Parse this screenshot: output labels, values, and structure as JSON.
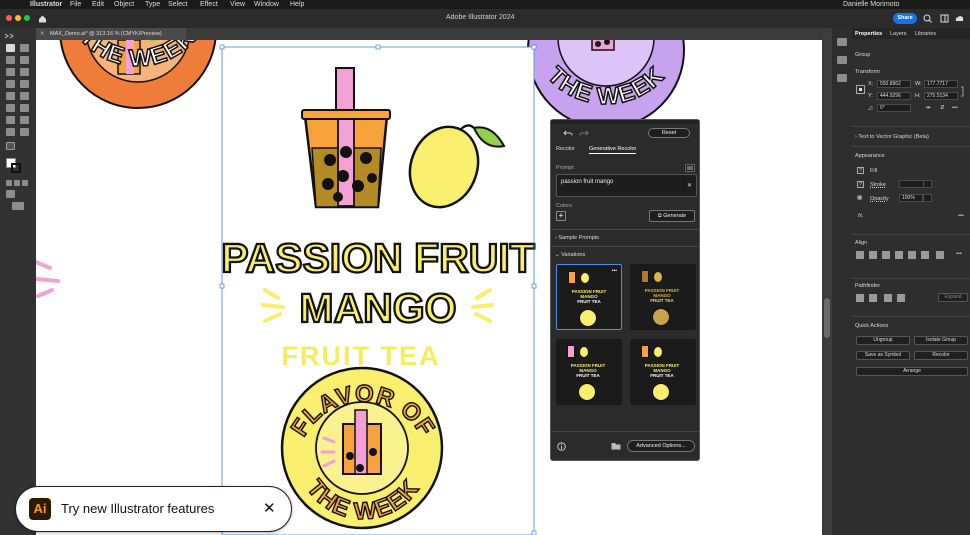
{
  "menubar": {
    "apple": "",
    "app_name": "Illustrator",
    "items": [
      "File",
      "Edit",
      "Object",
      "Type",
      "Select",
      "Effect",
      "View",
      "Window",
      "Help"
    ],
    "user": "Danielle Morimoto"
  },
  "titlebar": {
    "title": "Adobe Illustrator 2024",
    "share": "Share"
  },
  "doc_tab": {
    "label": "MAX_Demo.ai* @ 313.16 % (CMYK/Preview)"
  },
  "artwork": {
    "headline_1": "PASSION FRUIT",
    "headline_2": "MANGO",
    "subtitle": "FRUIT TEA",
    "badge_top": "FLAVOR OF",
    "badge_bottom": "THE WEEK",
    "partial_left": "THE WEEK",
    "partial_right": "THE WEEK"
  },
  "properties": {
    "tabs": [
      "Properties",
      "Layers",
      "Libraries"
    ],
    "group": "Group",
    "transform": "Transform",
    "x": "550.8962",
    "y": "444.9296",
    "w": "177.7717",
    "h": "275.5134",
    "angle": "0°",
    "text_to_vector": "Text to Vector Graphic (Beta)",
    "appearance": "Appearance",
    "fill": "Fill",
    "stroke": "Stroke",
    "opacity": "Opacity",
    "opacity_value": "100%",
    "fx": "fx.",
    "align": "Align",
    "pathfinder": "Pathfinder",
    "expand": "Expand",
    "quick_actions": "Quick Actions",
    "ungroup": "Ungroup",
    "isolate_group": "Isolate Group",
    "save_as_symbol": "Save as Symbol",
    "recolor": "Recolor",
    "arrange": "Arrange"
  },
  "recolor": {
    "reset": "Reset",
    "tab_recolor": "Recolor",
    "tab_generative": "Generative Recolor",
    "prompt_label": "Prompt",
    "prompt_value": "passion fruit mango",
    "colors_label": "Colors",
    "generate": "Generate",
    "sample_prompts": "Sample Prompts",
    "variations": "Variations",
    "thumb_line1": "PASSION FRUIT",
    "thumb_line2": "MANGO",
    "thumb_line3": "FRUIT TEA",
    "thumb_more": "•••",
    "advanced": "Advanced Options..."
  },
  "notification": {
    "logo": "Ai",
    "text": "Try new Illustrator features",
    "close": "✕"
  },
  "colors": {
    "yellow": "#f9ee6d",
    "pink": "#f2a0d6",
    "orange": "#f7a23a",
    "purple": "#c9a2ef",
    "accent": "#1473e6"
  }
}
